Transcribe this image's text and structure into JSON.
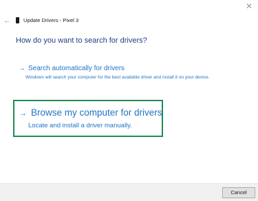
{
  "window": {
    "close_glyph": "✕",
    "back_glyph": "←",
    "title": "Update Drivers - Pixel 3"
  },
  "heading": "How do you want to search for drivers?",
  "options": [
    {
      "arrow": "→",
      "title": "Search automatically for drivers",
      "description": "Windows will search your computer for the best available driver and install it on your device."
    },
    {
      "arrow": "→",
      "title": "Browse my computer for drivers",
      "description": "Locate and install a driver manually.",
      "highlighted": true
    }
  ],
  "footer": {
    "cancel_label": "Cancel"
  },
  "colors": {
    "link": "#2174c6",
    "heading": "#1f3e88",
    "highlight_border": "#1e8a56",
    "footer_bg": "#f0f0f0"
  },
  "icons": {
    "close": "close-icon",
    "back": "back-arrow-icon",
    "device": "phone-icon"
  }
}
